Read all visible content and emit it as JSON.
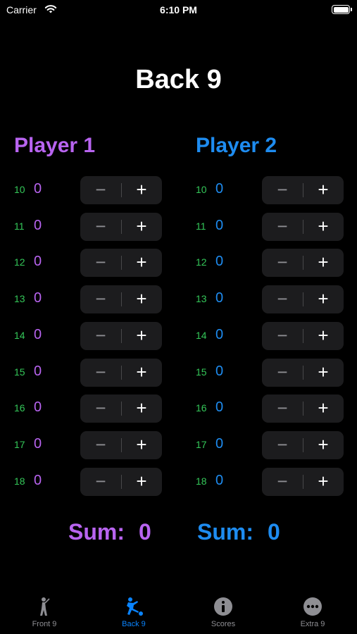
{
  "status": {
    "carrier": "Carrier",
    "time": "6:10 PM"
  },
  "title": "Back 9",
  "colors": {
    "player1": "#b864f0",
    "player2": "#1e8cf0",
    "hole": "#34c759",
    "active_tab": "#0a84ff"
  },
  "stepper": {
    "minus": "−",
    "plus": "+"
  },
  "players": [
    {
      "name": "Player 1",
      "rows": [
        {
          "hole": "10",
          "score": "0"
        },
        {
          "hole": "11",
          "score": "0"
        },
        {
          "hole": "12",
          "score": "0"
        },
        {
          "hole": "13",
          "score": "0"
        },
        {
          "hole": "14",
          "score": "0"
        },
        {
          "hole": "15",
          "score": "0"
        },
        {
          "hole": "16",
          "score": "0"
        },
        {
          "hole": "17",
          "score": "0"
        },
        {
          "hole": "18",
          "score": "0"
        }
      ],
      "sum_label": "Sum:",
      "sum_value": "0"
    },
    {
      "name": "Player 2",
      "rows": [
        {
          "hole": "10",
          "score": "0"
        },
        {
          "hole": "11",
          "score": "0"
        },
        {
          "hole": "12",
          "score": "0"
        },
        {
          "hole": "13",
          "score": "0"
        },
        {
          "hole": "14",
          "score": "0"
        },
        {
          "hole": "15",
          "score": "0"
        },
        {
          "hole": "16",
          "score": "0"
        },
        {
          "hole": "17",
          "score": "0"
        },
        {
          "hole": "18",
          "score": "0"
        }
      ],
      "sum_label": "Sum:",
      "sum_value": "0"
    }
  ],
  "tabs": [
    {
      "label": "Front 9",
      "icon": "golfer-icon",
      "active": false
    },
    {
      "label": "Back 9",
      "icon": "kick-icon",
      "active": true
    },
    {
      "label": "Scores",
      "icon": "info-icon",
      "active": false
    },
    {
      "label": "Extra 9",
      "icon": "more-icon",
      "active": false
    }
  ]
}
